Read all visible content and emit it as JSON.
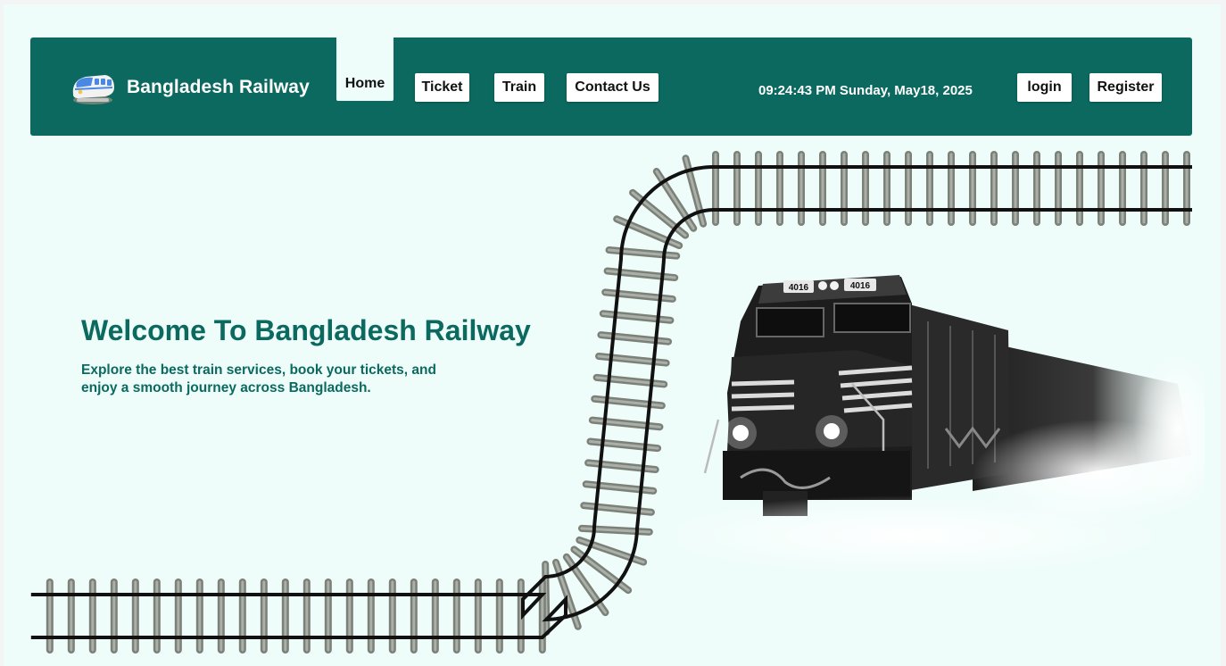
{
  "navbar": {
    "brand": "Bangladesh Railway",
    "brand_icon": "train-icon",
    "links": {
      "home": "Home",
      "ticket": "Ticket",
      "train": "Train",
      "contact": "Contact Us"
    },
    "datetime": "09:24:43 PM Sunday, May18, 2025",
    "login": "login",
    "register": "Register"
  },
  "hero": {
    "title": "Welcome To Bangladesh Railway",
    "subtitle_line1": "Explore the best train services, book your tickets, and",
    "subtitle_line2": "enjoy a smooth journey across Bangladesh.",
    "locomotive_number": "4016",
    "illustration": "railway-track-and-locomotive"
  },
  "colors": {
    "primary": "#0b695f",
    "background": "#eefdfa",
    "button_bg": "#ffffff"
  }
}
